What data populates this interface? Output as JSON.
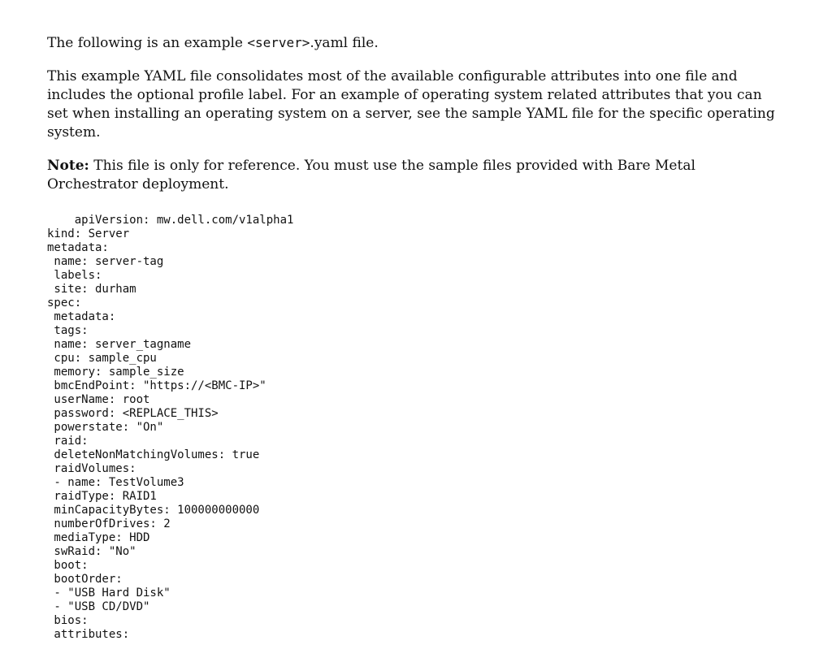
{
  "para1": {
    "before": "The following is an example ",
    "tt": "<server>",
    "after": ".yaml file."
  },
  "para2": "This example YAML file consolidates most of the available configurable attributes into one file and includes the optional profile label. For an example of operating system related attributes that you can set when installing an operating system on a server, see the sample YAML file for the specific operating system.",
  "para3": {
    "label": "Note:",
    "text": " This file is only for reference. You must use the sample files provided with Bare Metal Orchestrator deployment."
  },
  "code": "    apiVersion: mw.dell.com/v1alpha1\nkind: Server\nmetadata:\n name: server-tag\n labels:\n site: durham\nspec:\n metadata:\n tags:\n name: server_tagname\n cpu: sample_cpu\n memory: sample_size\n bmcEndPoint: \"https://<BMC-IP>\"\n userName: root\n password: <REPLACE_THIS>\n powerstate: \"On\"\n raid:\n deleteNonMatchingVolumes: true\n raidVolumes:\n - name: TestVolume3\n raidType: RAID1\n minCapacityBytes: 100000000000\n numberOfDrives: 2\n mediaType: HDD\n swRaid: \"No\"\n boot:\n bootOrder:\n - \"USB Hard Disk\"\n - \"USB CD/DVD\"\n bios:\n attributes:"
}
